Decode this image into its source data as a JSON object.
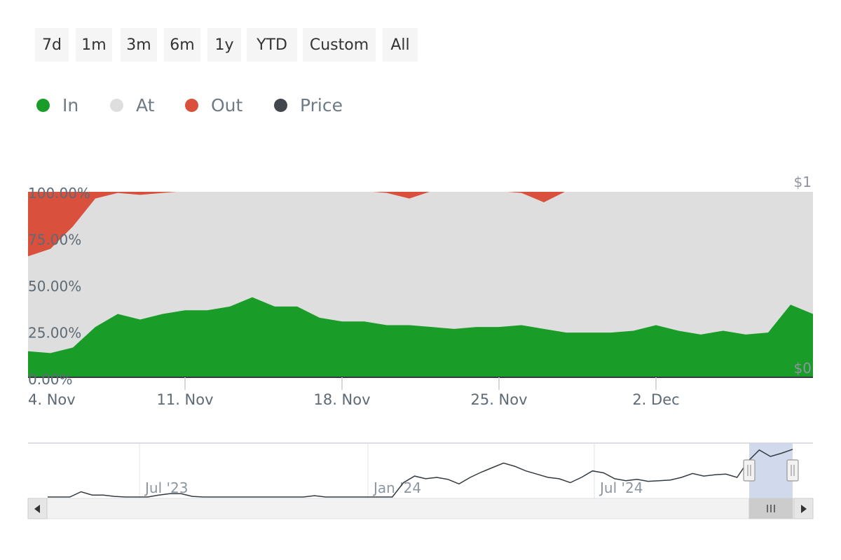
{
  "range_selector": {
    "buttons": [
      {
        "label": "7d"
      },
      {
        "label": "1m"
      },
      {
        "label": "3m"
      },
      {
        "label": "6m"
      },
      {
        "label": "1y"
      },
      {
        "label": "YTD"
      },
      {
        "label": "Custom"
      },
      {
        "label": "All"
      }
    ]
  },
  "legend": {
    "items": [
      {
        "label": "In",
        "color": "#1a9c29"
      },
      {
        "label": "At",
        "color": "#dedede"
      },
      {
        "label": "Out",
        "color": "#d9513c"
      },
      {
        "label": "Price",
        "color": "#42464d"
      }
    ]
  },
  "chart_data": {
    "type": "area",
    "stacking": "percent",
    "x_ticks": [
      "4. Nov",
      "11. Nov",
      "18. Nov",
      "25. Nov",
      "2. Dec"
    ],
    "y_ticks": [
      "0.00%",
      "25.00%",
      "50.00%",
      "75.00%",
      "100.00%"
    ],
    "y2_ticks": [
      "$0",
      "$1"
    ],
    "ylim": [
      0,
      100
    ],
    "x": [
      "2024-11-04",
      "2024-11-05",
      "2024-11-06",
      "2024-11-07",
      "2024-11-08",
      "2024-11-09",
      "2024-11-10",
      "2024-11-11",
      "2024-11-12",
      "2024-11-13",
      "2024-11-14",
      "2024-11-15",
      "2024-11-16",
      "2024-11-17",
      "2024-11-18",
      "2024-11-19",
      "2024-11-20",
      "2024-11-21",
      "2024-11-22",
      "2024-11-23",
      "2024-11-24",
      "2024-11-25",
      "2024-11-26",
      "2024-11-27",
      "2024-11-28",
      "2024-11-29",
      "2024-11-30",
      "2024-12-01",
      "2024-12-02",
      "2024-12-03",
      "2024-12-04",
      "2024-12-05",
      "2024-12-06",
      "2024-12-07",
      "2024-12-08",
      "2024-12-09"
    ],
    "series": [
      {
        "name": "In",
        "color": "#1a9c29",
        "values": [
          14,
          13,
          16,
          27,
          34,
          31,
          34,
          36,
          36,
          38,
          43,
          38,
          38,
          32,
          30,
          30,
          28,
          28,
          27,
          26,
          27,
          27,
          28,
          26,
          24,
          24,
          24,
          25,
          28,
          25,
          23,
          25,
          23,
          24,
          39,
          34
        ]
      },
      {
        "name": "Out",
        "color": "#d9513c",
        "values": [
          35,
          31,
          19,
          4,
          1,
          2,
          1,
          0,
          0,
          0,
          0,
          0,
          0,
          0,
          0,
          0,
          1,
          4,
          0,
          0,
          0,
          0,
          1,
          6,
          0,
          0,
          0,
          0,
          0,
          0,
          0,
          0,
          0,
          0,
          0,
          0
        ]
      }
    ],
    "navigator": {
      "x_ticks": [
        "Jul '23",
        "Jan '24",
        "Jul '24"
      ],
      "series": [
        0,
        0,
        0,
        0.08,
        0.03,
        0.03,
        0.01,
        0,
        0,
        0,
        0.03,
        0.05,
        0.05,
        0.01,
        0,
        0,
        0,
        0,
        0,
        0,
        0,
        0,
        0,
        0,
        0.02,
        0,
        0,
        0,
        0,
        0,
        0,
        0,
        0.22,
        0.32,
        0.28,
        0.3,
        0.27,
        0.2,
        0.3,
        0.38,
        0.45,
        0.52,
        0.47,
        0.4,
        0.35,
        0.3,
        0.28,
        0.22,
        0.3,
        0.4,
        0.37,
        0.28,
        0.25,
        0.27,
        0.24,
        0.25,
        0.26,
        0.3,
        0.36,
        0.32,
        0.34,
        0.35,
        0.3,
        0.55,
        0.72,
        0.62,
        0.67,
        0.73
      ]
    }
  }
}
